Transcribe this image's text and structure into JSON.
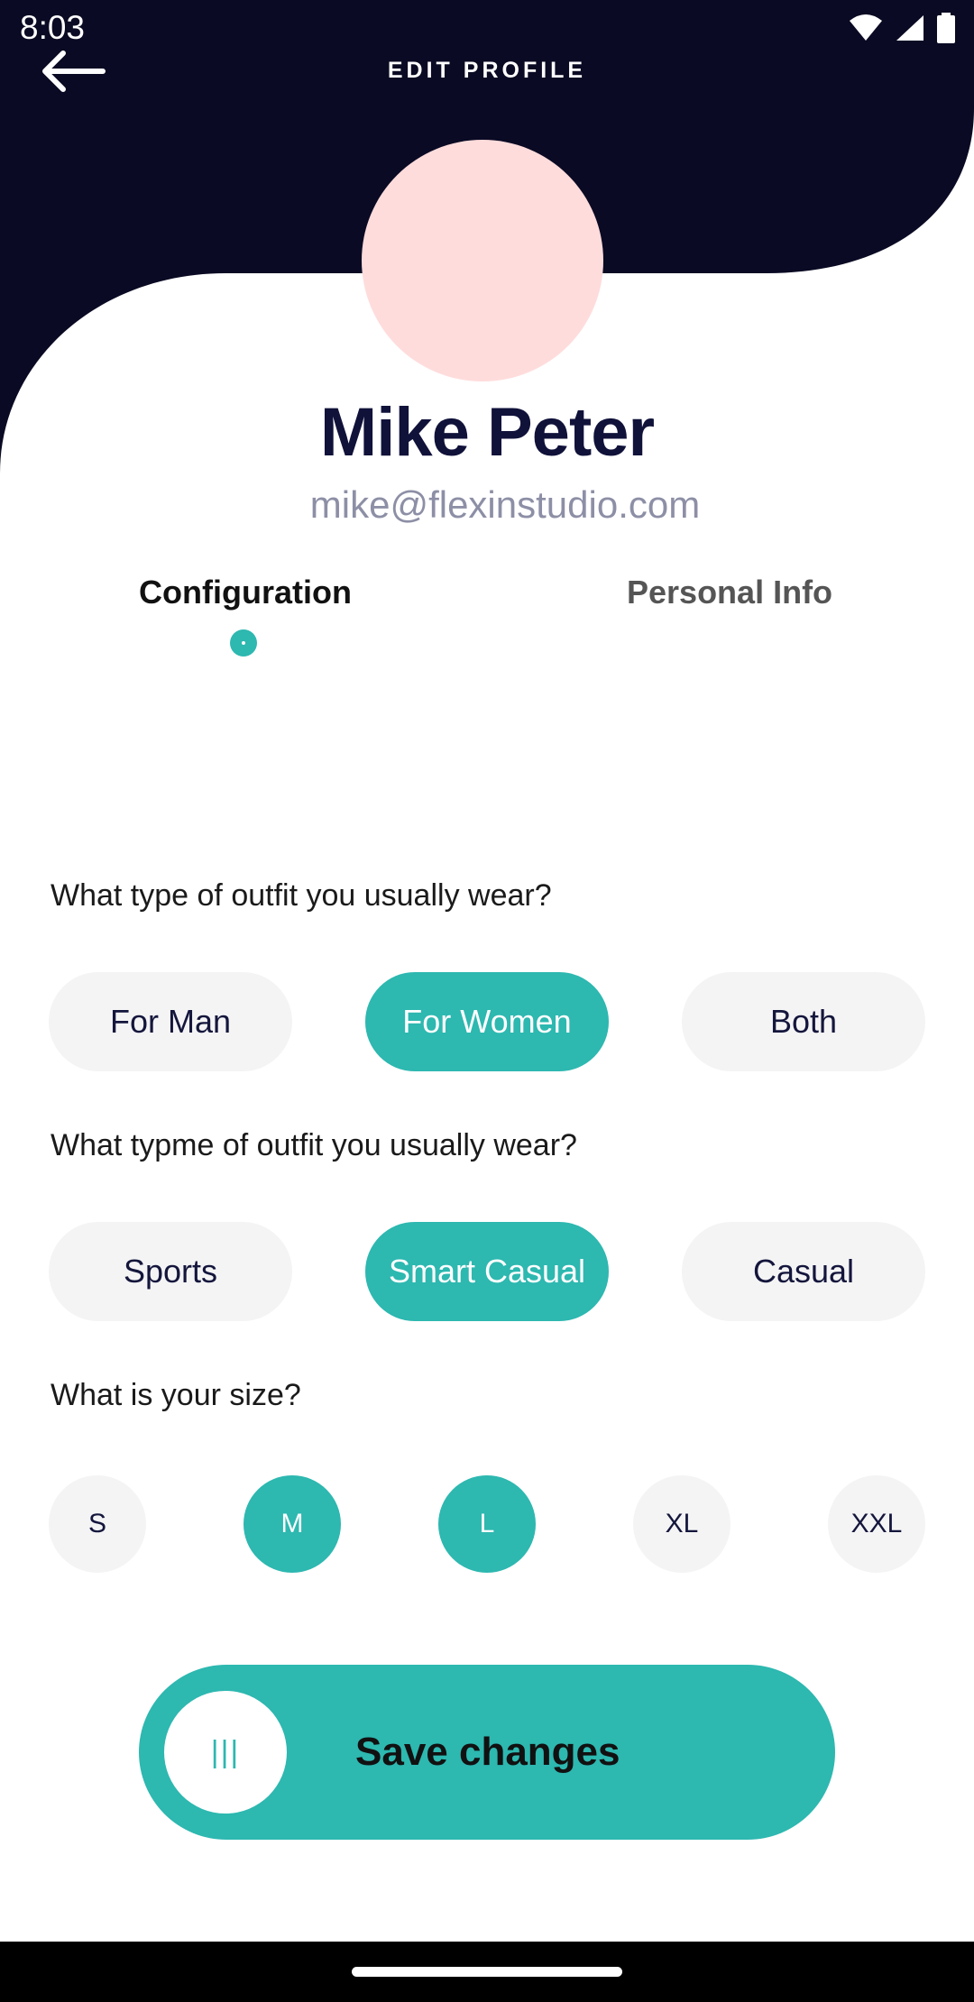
{
  "status_bar": {
    "time": "8:03"
  },
  "header": {
    "title": "EDIT PROFILE",
    "back_icon": "arrow-left-icon"
  },
  "profile": {
    "name": "Mike Peter",
    "email": "mike@flexinstudio.com"
  },
  "tabs": [
    {
      "label": "Configuration",
      "active": true
    },
    {
      "label": "Personal Info",
      "active": false
    }
  ],
  "questions": [
    {
      "text": "What type of outfit you usually wear?",
      "options": [
        {
          "label": "For Man",
          "selected": false
        },
        {
          "label": "For Women",
          "selected": true
        },
        {
          "label": "Both",
          "selected": false
        }
      ]
    },
    {
      "text": "What typme of outfit you usually wear?",
      "options": [
        {
          "label": "Sports",
          "selected": false
        },
        {
          "label": "Smart Casual",
          "selected": true
        },
        {
          "label": "Casual",
          "selected": false
        }
      ]
    },
    {
      "text": "What is your size?",
      "options": [
        {
          "label": "S",
          "selected": false
        },
        {
          "label": "M",
          "selected": true
        },
        {
          "label": "L",
          "selected": true
        },
        {
          "label": "XL",
          "selected": false
        },
        {
          "label": "XXL",
          "selected": false
        }
      ]
    }
  ],
  "save_button": {
    "label": "Save changes",
    "knob_icon": "grip-lines-icon"
  },
  "colors": {
    "navy": "#0a0a24",
    "accent": "#2db8b0",
    "avatar": "#ffdcdc",
    "pill": "#f4f4f5"
  }
}
